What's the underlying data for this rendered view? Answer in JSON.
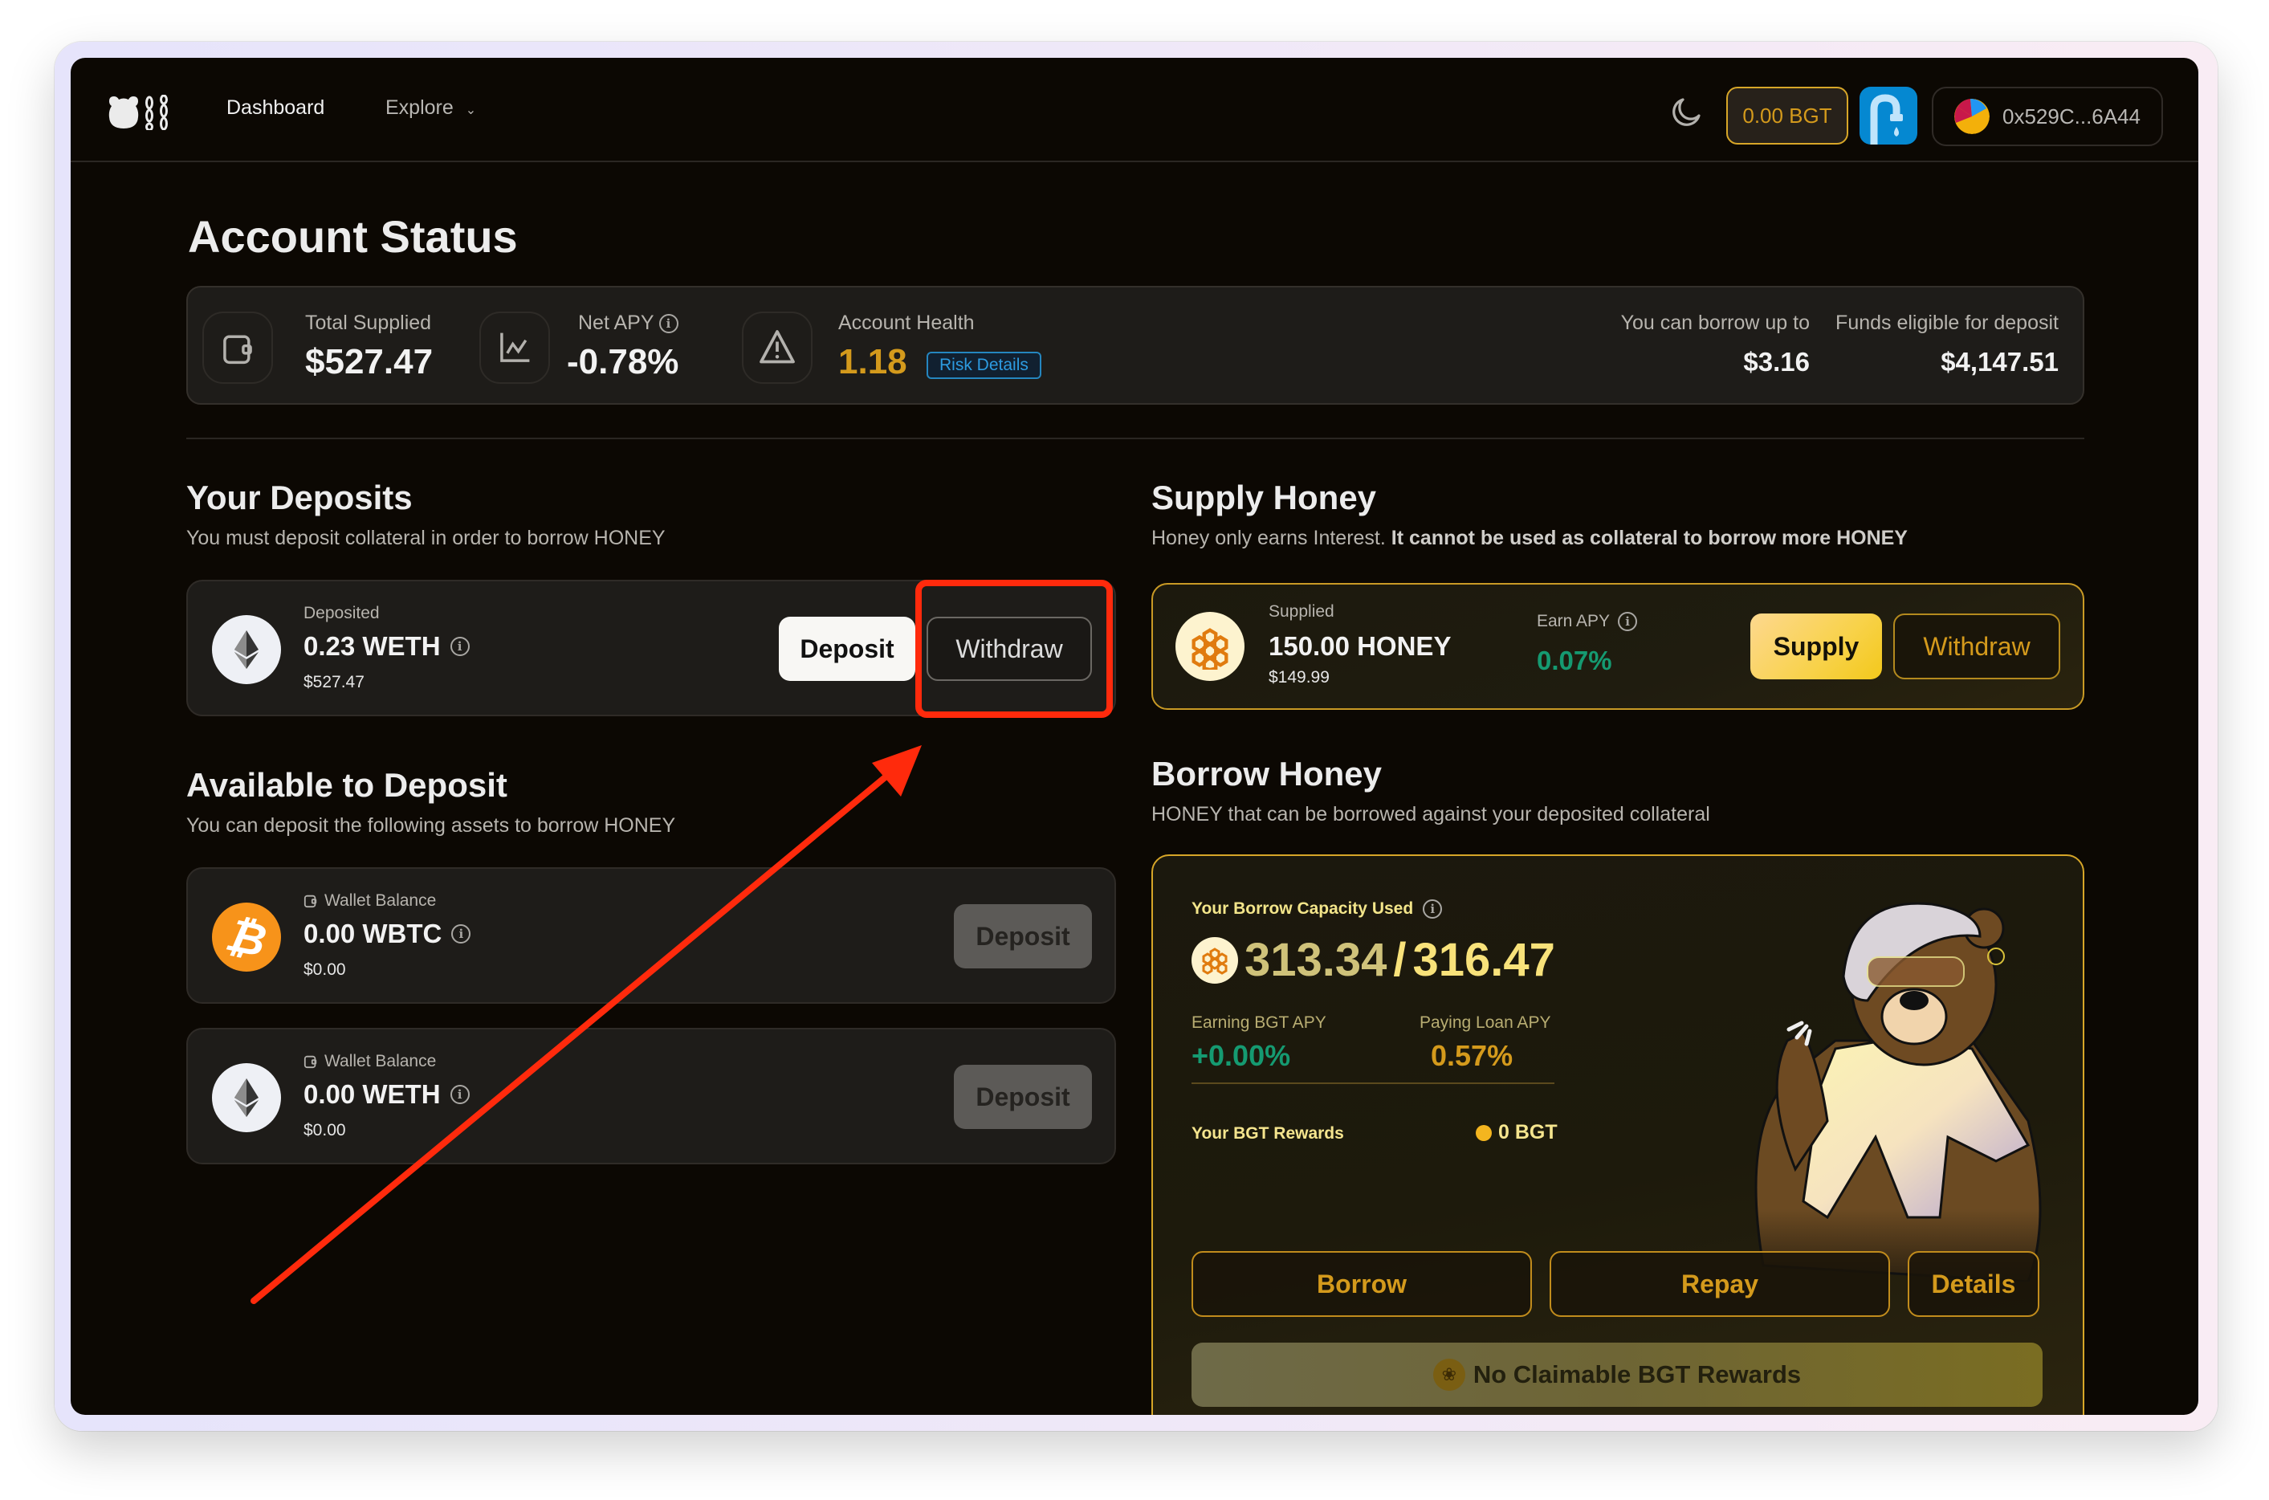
{
  "nav": {
    "logo": "bear-logo",
    "links": [
      {
        "label": "Dashboard"
      },
      {
        "label": "Explore",
        "has_dropdown": true
      }
    ],
    "theme_toggle": "moon-icon",
    "bgt_balance": "0.00 BGT",
    "faucet": "faucet-icon",
    "wallet_address": "0x529C...6A44"
  },
  "account_status": {
    "title": "Account Status",
    "total_supplied_label": "Total Supplied",
    "total_supplied_value": "$527.47",
    "net_apy_label": "Net APY",
    "net_apy_value": "-0.78%",
    "account_health_label": "Account Health",
    "account_health_value": "1.18",
    "risk_details_label": "Risk Details",
    "borrow_up_to_label": "You can borrow up to",
    "borrow_up_to_value": "$3.16",
    "eligible_label": "Funds eligible for deposit",
    "eligible_value": "$4,147.51"
  },
  "your_deposits": {
    "title": "Your Deposits",
    "subtitle": "You must deposit collateral in order to borrow HONEY",
    "items": [
      {
        "label": "Deposited",
        "amount": "0.23 WETH",
        "usd": "$527.47",
        "icon": "eth-icon",
        "deposit_label": "Deposit",
        "withdraw_label": "Withdraw"
      }
    ]
  },
  "available_to_deposit": {
    "title": "Available to Deposit",
    "subtitle": "You can deposit the following assets to borrow HONEY",
    "items": [
      {
        "label": "Wallet Balance",
        "amount": "0.00 WBTC",
        "usd": "$0.00",
        "icon": "btc-icon",
        "deposit_label": "Deposit"
      },
      {
        "label": "Wallet Balance",
        "amount": "0.00 WETH",
        "usd": "$0.00",
        "icon": "eth-icon",
        "deposit_label": "Deposit"
      }
    ]
  },
  "supply_honey": {
    "title": "Supply Honey",
    "subtitle_plain": "Honey only earns Interest. ",
    "subtitle_bold": "It cannot be used as collateral to borrow more HONEY",
    "supplied_label": "Supplied",
    "supplied_amount": "150.00 HONEY",
    "supplied_usd": "$149.99",
    "earn_apy_label": "Earn APY",
    "earn_apy_value": "0.07%",
    "supply_label": "Supply",
    "withdraw_label": "Withdraw"
  },
  "borrow_honey": {
    "title": "Borrow Honey",
    "subtitle": "HONEY that can be borrowed against your deposited collateral",
    "capacity_label": "Your Borrow Capacity Used",
    "capacity_used": "313.34",
    "capacity_sep": "/",
    "capacity_total": "316.47",
    "earning_bgt_apy_label": "Earning BGT APY",
    "earning_bgt_apy_value": "+0.00%",
    "paying_loan_apy_label": "Paying Loan APY",
    "paying_loan_apy_value": "0.57%",
    "rewards_label": "Your BGT Rewards",
    "rewards_value": "0 BGT",
    "borrow_label": "Borrow",
    "repay_label": "Repay",
    "details_label": "Details",
    "claim_label": "No Claimable BGT Rewards"
  },
  "colors": {
    "background": "#0c0803",
    "card": "#1e1c19",
    "honey_gold": "#d49a1c",
    "positive_green": "#159a71",
    "link_blue": "#2d9be0",
    "annotation_red": "#ff2a0c"
  }
}
